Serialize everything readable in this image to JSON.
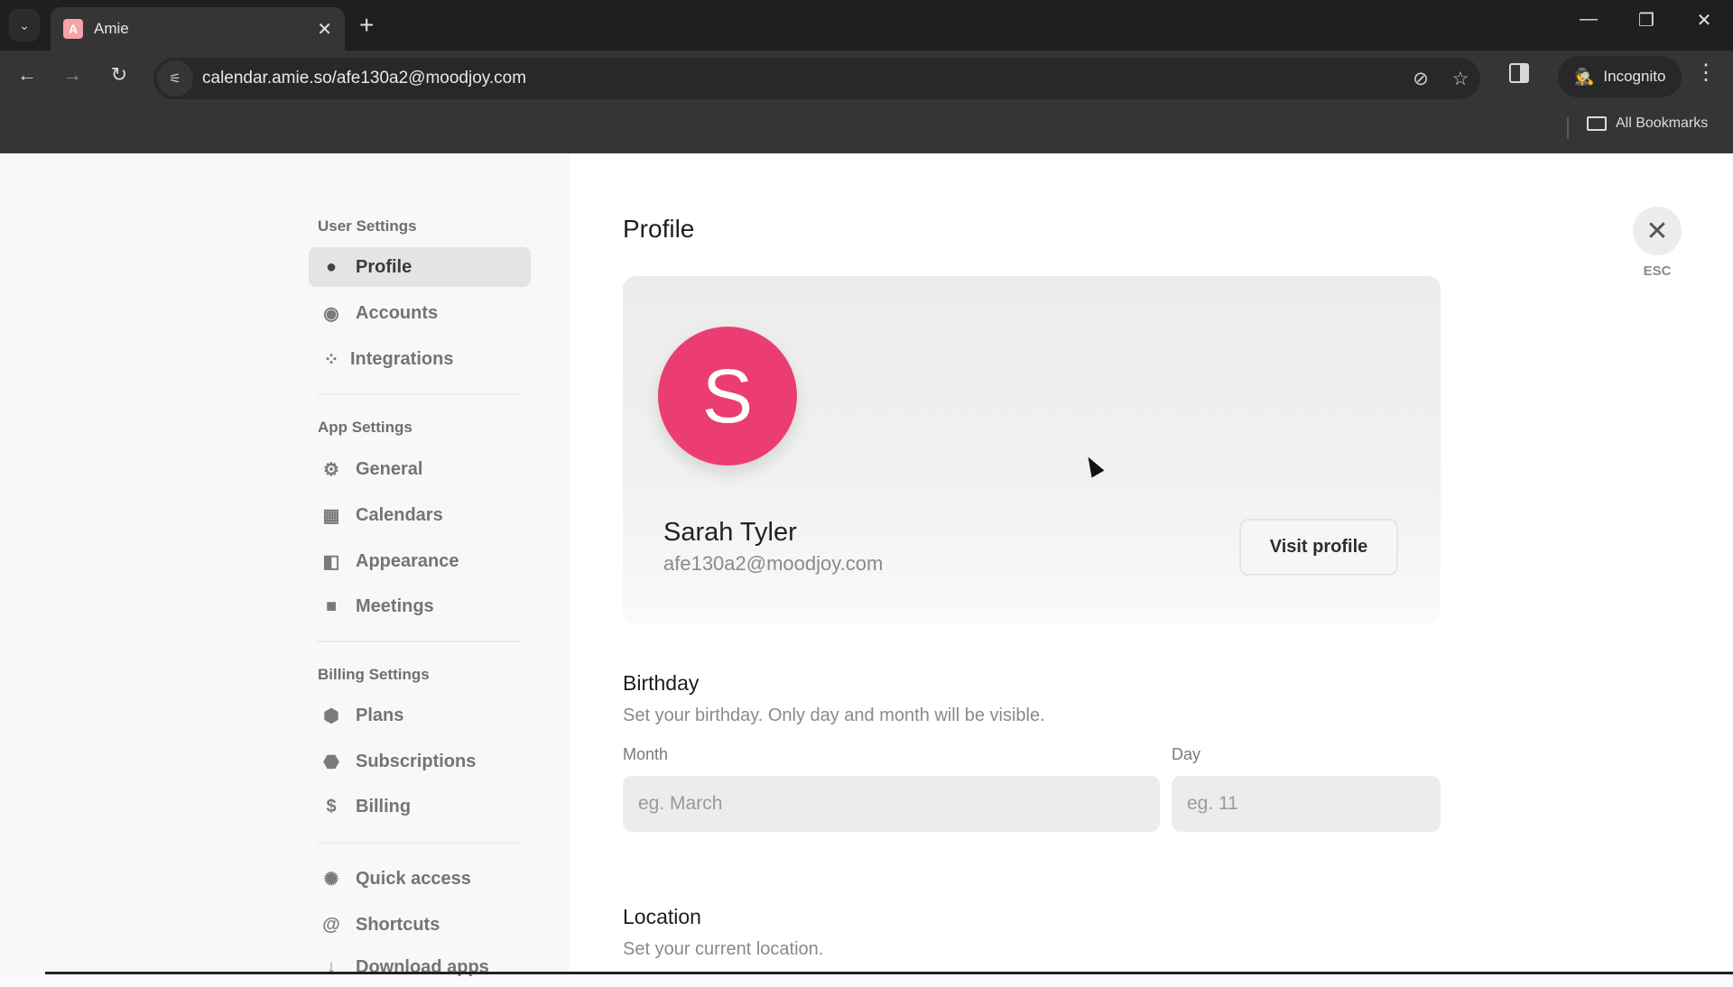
{
  "browser": {
    "tab_title": "Amie",
    "tab_favicon_letter": "A",
    "url": "calendar.amie.so/afe130a2@moodjoy.com",
    "incognito_label": "Incognito",
    "bookmarks_label": "All Bookmarks",
    "icons": {
      "tab_search": "⌄",
      "tab_close": "✕",
      "new_tab": "+",
      "minimize": "—",
      "restore": "❐",
      "window_close": "✕",
      "back": "←",
      "forward": "→",
      "reload": "↻",
      "site_info": "⚟",
      "eye_off": "⊘",
      "star": "☆",
      "incognito": "🕵",
      "menu": "⋮"
    }
  },
  "sidebar": {
    "sections": [
      {
        "heading": "User Settings"
      },
      {
        "heading": "App Settings"
      },
      {
        "heading": "Billing Settings"
      }
    ],
    "items": [
      {
        "label": "Profile",
        "icon": "●",
        "active": true
      },
      {
        "label": "Accounts",
        "icon": "◉"
      },
      {
        "label": "Integrations",
        "icon": "⁘"
      },
      {
        "label": "General",
        "icon": "⚙"
      },
      {
        "label": "Calendars",
        "icon": "▦"
      },
      {
        "label": "Appearance",
        "icon": "◧"
      },
      {
        "label": "Meetings",
        "icon": "■"
      },
      {
        "label": "Plans",
        "icon": "⬢"
      },
      {
        "label": "Subscriptions",
        "icon": "⬣"
      },
      {
        "label": "Billing",
        "icon": "$"
      },
      {
        "label": "Quick access",
        "icon": "✺"
      },
      {
        "label": "Shortcuts",
        "icon": "@"
      },
      {
        "label": "Download apps",
        "icon": "↓"
      }
    ]
  },
  "main": {
    "title": "Profile",
    "close_icon": "✕",
    "esc_label": "ESC",
    "profile": {
      "avatar_letter": "S",
      "avatar_color": "#ec3d73",
      "name": "Sarah Tyler",
      "email": "afe130a2@moodjoy.com",
      "visit_button": "Visit profile"
    },
    "birthday": {
      "title": "Birthday",
      "description": "Set your birthday. Only day and month will be visible.",
      "month_label": "Month",
      "month_placeholder": "eg. March",
      "month_value": "",
      "day_label": "Day",
      "day_placeholder": "eg. 11",
      "day_value": ""
    },
    "location": {
      "title": "Location",
      "description": "Set your current location."
    }
  }
}
